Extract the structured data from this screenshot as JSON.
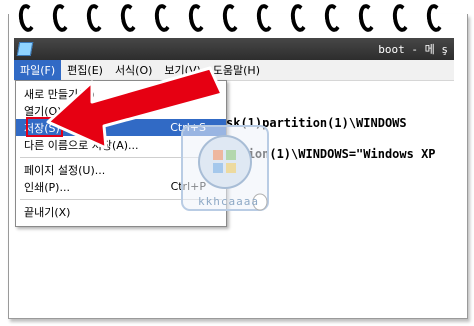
{
  "window": {
    "title": "boot - 메 ş"
  },
  "menubar": {
    "items": [
      "파일(F)",
      "편집(E)",
      "서식(O)",
      "보기(V)",
      "도움말(H)"
    ],
    "active_index": 0
  },
  "file_menu": {
    "items": [
      {
        "label": "새로 만들기(N)",
        "shortcut": ""
      },
      {
        "label": "열기(O)...",
        "shortcut": ""
      },
      {
        "label": "저장(S)",
        "shortcut": "Ctrl+S"
      },
      {
        "label": "다른 이름으로 저장(A)...",
        "shortcut": ""
      },
      {
        "label": "페이지 설정(U)...",
        "shortcut": ""
      },
      {
        "label": "인쇄(P)...",
        "shortcut": "Ctrl+P"
      },
      {
        "label": "끝내기(X)",
        "shortcut": ""
      }
    ],
    "selected_index": 2
  },
  "editor": {
    "line1": "sk(1)partition(1)\\WINDOWS",
    "line2": "tition(1)\\WINDOWS=\"Windows XP"
  },
  "watermark": {
    "text": "kkhcaaaa"
  },
  "colors": {
    "highlight": "#e0001a",
    "selection": "#316ac5",
    "titlebar": "#3a3a3a"
  }
}
